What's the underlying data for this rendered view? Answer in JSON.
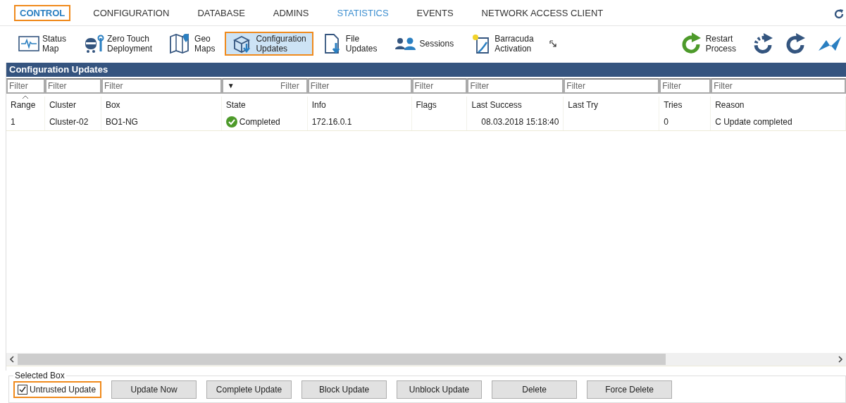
{
  "nav_tabs": [
    {
      "label": "CONTROL",
      "selected": true,
      "highlighted": false
    },
    {
      "label": "CONFIGURATION",
      "selected": false,
      "highlighted": false
    },
    {
      "label": "DATABASE",
      "selected": false,
      "highlighted": false
    },
    {
      "label": "ADMINS",
      "selected": false,
      "highlighted": false
    },
    {
      "label": "STATISTICS",
      "selected": false,
      "highlighted": true
    },
    {
      "label": "EVENTS",
      "selected": false,
      "highlighted": false
    },
    {
      "label": "NETWORK ACCESS CLIENT",
      "selected": false,
      "highlighted": false
    }
  ],
  "toolbar": {
    "items": [
      {
        "label": [
          "Status",
          "Map"
        ],
        "selected": false
      },
      {
        "label": [
          "Zero Touch",
          "Deployment"
        ],
        "selected": false
      },
      {
        "label": [
          "Geo",
          "Maps"
        ],
        "selected": false
      },
      {
        "label": [
          "Configuration",
          "Updates"
        ],
        "selected": true
      },
      {
        "label": [
          "File",
          "Updates"
        ],
        "selected": false
      },
      {
        "label": [
          "Sessions"
        ],
        "selected": false
      },
      {
        "label": [
          "Barracuda",
          "Activation"
        ],
        "selected": false
      }
    ],
    "restart": {
      "label": [
        "Restart",
        "Process"
      ]
    }
  },
  "panel": {
    "title": "Configuration Updates",
    "filters": [
      {
        "placeholder": "Filter",
        "kind": "text"
      },
      {
        "placeholder": "Filter",
        "kind": "text"
      },
      {
        "placeholder": "Filter",
        "kind": "text"
      },
      {
        "placeholder": "Filter",
        "kind": "dropdown",
        "caret": "▼"
      },
      {
        "placeholder": "Filter",
        "kind": "text"
      },
      {
        "placeholder": "Filter",
        "kind": "text"
      },
      {
        "placeholder": "Filter",
        "kind": "text"
      },
      {
        "placeholder": "Filter",
        "kind": "text"
      },
      {
        "placeholder": "Filter",
        "kind": "text"
      },
      {
        "placeholder": "Filter",
        "kind": "text"
      }
    ],
    "columns": [
      "Range",
      "Cluster",
      "Box",
      "State",
      "Info",
      "Flags",
      "Last Success",
      "Last Try",
      "Tries",
      "Reason"
    ],
    "rows": [
      {
        "cells": [
          "1",
          "Cluster-02",
          "BO1-NG",
          "Completed",
          "172.16.0.1",
          "",
          "08.03.2018 15:18:40",
          "",
          "0",
          "C Update completed"
        ],
        "completed": true
      }
    ]
  },
  "selected_box": {
    "title": "Selected Box",
    "checkbox": {
      "label": "Untrusted Update",
      "checked": true
    },
    "buttons": [
      "Update Now",
      "Complete Update",
      "Block Update",
      "Unblock Update",
      "Delete",
      "Force Delete"
    ]
  }
}
